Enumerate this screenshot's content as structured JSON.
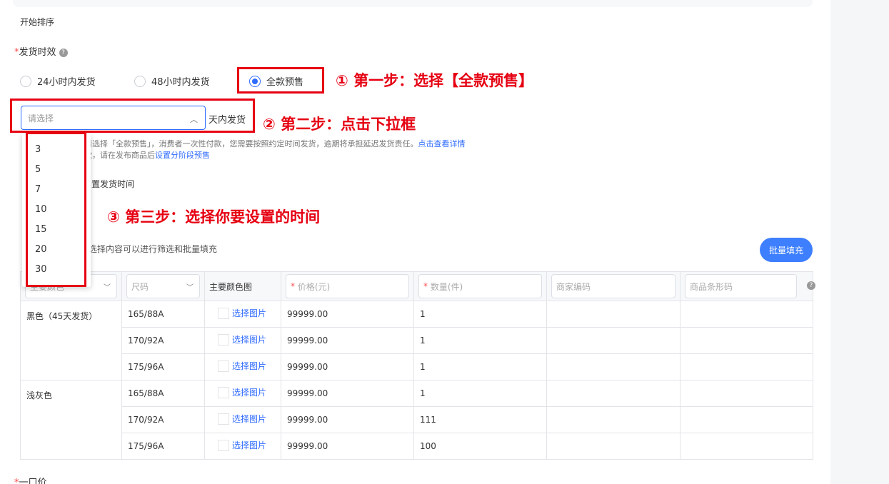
{
  "section": {
    "start_sort": "开始排序",
    "delivery_label": "发货时效",
    "required_mark": "*",
    "help_icon": "?"
  },
  "radios": [
    {
      "label": "24小时内发货",
      "checked": false
    },
    {
      "label": "48小时内发货",
      "checked": false
    },
    {
      "label": "全款预售",
      "checked": true
    }
  ],
  "select": {
    "placeholder": "请选择",
    "suffix": "天内发货",
    "options": [
      "3",
      "5",
      "7",
      "10",
      "15",
      "20",
      "30"
    ]
  },
  "hint": {
    "line1_prefix": "请选择「全款预售」，消费者一次性付款，您需要按照约定时间发货，逾期将承担延迟发货责任。",
    "line1_link": "点击查看详情",
    "line2_prefix": "款，请在发布商品后",
    "line2_link": "设置分阶段预售",
    "set_time_label": "置发货时间",
    "table_hint": "选择内容可以进行筛选和批量填充"
  },
  "annotations": {
    "step1": "① 第一步：选择【全款预售】",
    "step2": "② 第二步：点击下拉框",
    "step3": "③ 第三步：选择你要设置的时间"
  },
  "batch_button": "批量填充",
  "table": {
    "headers": {
      "color": "主要颜色",
      "size": "尺码",
      "main_color_pic": "主要颜色图",
      "price": "价格(元)",
      "quantity": "数量(件)",
      "merchant_code": "商家编码",
      "barcode": "商品条形码"
    },
    "pick_image": "选择图片",
    "groups": [
      {
        "color": "黑色（45天发货）",
        "rows": [
          {
            "size": "165/88A",
            "price": "99999.00",
            "qty": "1"
          },
          {
            "size": "170/92A",
            "price": "99999.00",
            "qty": "1"
          },
          {
            "size": "175/96A",
            "price": "99999.00",
            "qty": "1"
          }
        ]
      },
      {
        "color": "浅灰色",
        "rows": [
          {
            "size": "165/88A",
            "price": "99999.00",
            "qty": "1"
          },
          {
            "size": "170/92A",
            "price": "99999.00",
            "qty": "111"
          },
          {
            "size": "175/96A",
            "price": "99999.00",
            "qty": "100"
          }
        ]
      }
    ]
  },
  "bottom_label": "一口价",
  "colors": {
    "accent": "#2f6bff",
    "annotation": "#e60012",
    "button": "#3d7ffe"
  }
}
